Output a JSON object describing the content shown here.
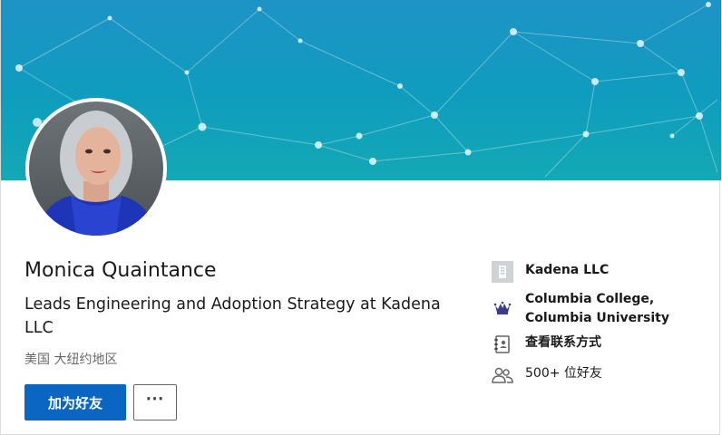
{
  "profile": {
    "name": "Monica Quaintance",
    "headline": "Leads Engineering and Adoption Strategy at Kadena LLC",
    "location": "美国 大纽约地区"
  },
  "actions": {
    "connect_label": "加为好友",
    "more_label": "⋯"
  },
  "sidebar": {
    "company": {
      "label": "Kadena LLC",
      "icon": "company-logo-icon"
    },
    "education": {
      "line1": "Columbia College,",
      "line2": "Columbia University",
      "icon": "crown-crest-icon"
    },
    "contact": {
      "label": "查看联系方式",
      "icon": "contact-card-icon"
    },
    "connections": {
      "label": "500+ 位好友",
      "icon": "people-icon"
    }
  },
  "colors": {
    "primary_button": "#0a66c2",
    "banner_start": "#1e93c6",
    "banner_end": "#13a9b5",
    "education_crest": "#3c3c8c"
  }
}
